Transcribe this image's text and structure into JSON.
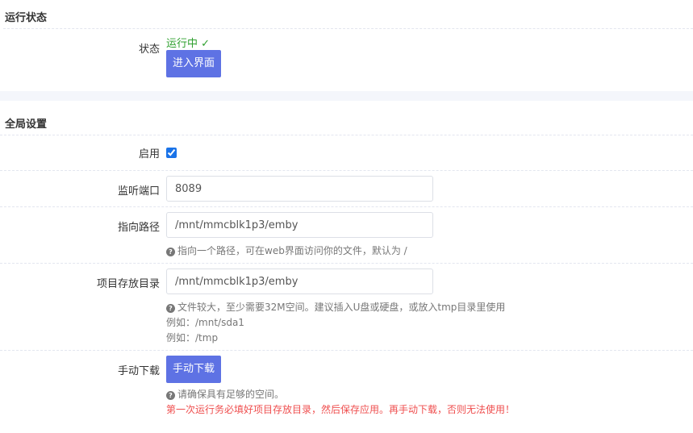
{
  "sections": {
    "run_status": {
      "title": "运行状态",
      "status_label": "状态",
      "status_text": "运行中 ✓",
      "enter_ui_button": "进入界面"
    },
    "global_settings": {
      "title": "全局设置",
      "enable_label": "启用",
      "enable_checked": true,
      "port_label": "监听端口",
      "port_value": "8089",
      "path_label": "指向路径",
      "path_value": "/mnt/mmcblk1p3/emby",
      "path_help": "指向一个路径，可在web界面访问你的文件，默认为 /",
      "project_dir_label": "项目存放目录",
      "project_dir_value": "/mnt/mmcblk1p3/emby",
      "project_dir_help": "文件较大，至少需要32M空间。建议插入U盘或硬盘，或放入tmp目录里使用",
      "project_dir_example1": "例如：/mnt/sda1",
      "project_dir_example2": "例如：/tmp",
      "manual_download_label": "手动下载",
      "manual_download_button": "手动下载",
      "manual_download_help": "请确保具有足够的空间。",
      "manual_download_warning": "第一次运行务必填好项目存放目录，然后保存应用。再手动下载，否则无法使用！"
    }
  },
  "icons": {
    "help_icon": "question-circle",
    "checkbox_icon": "checkbox-checked"
  },
  "colors": {
    "accent": "#5e72e4",
    "running": "#2d9f2d",
    "warning": "#ef4f4f",
    "section_gap": "#f4f6fb"
  }
}
